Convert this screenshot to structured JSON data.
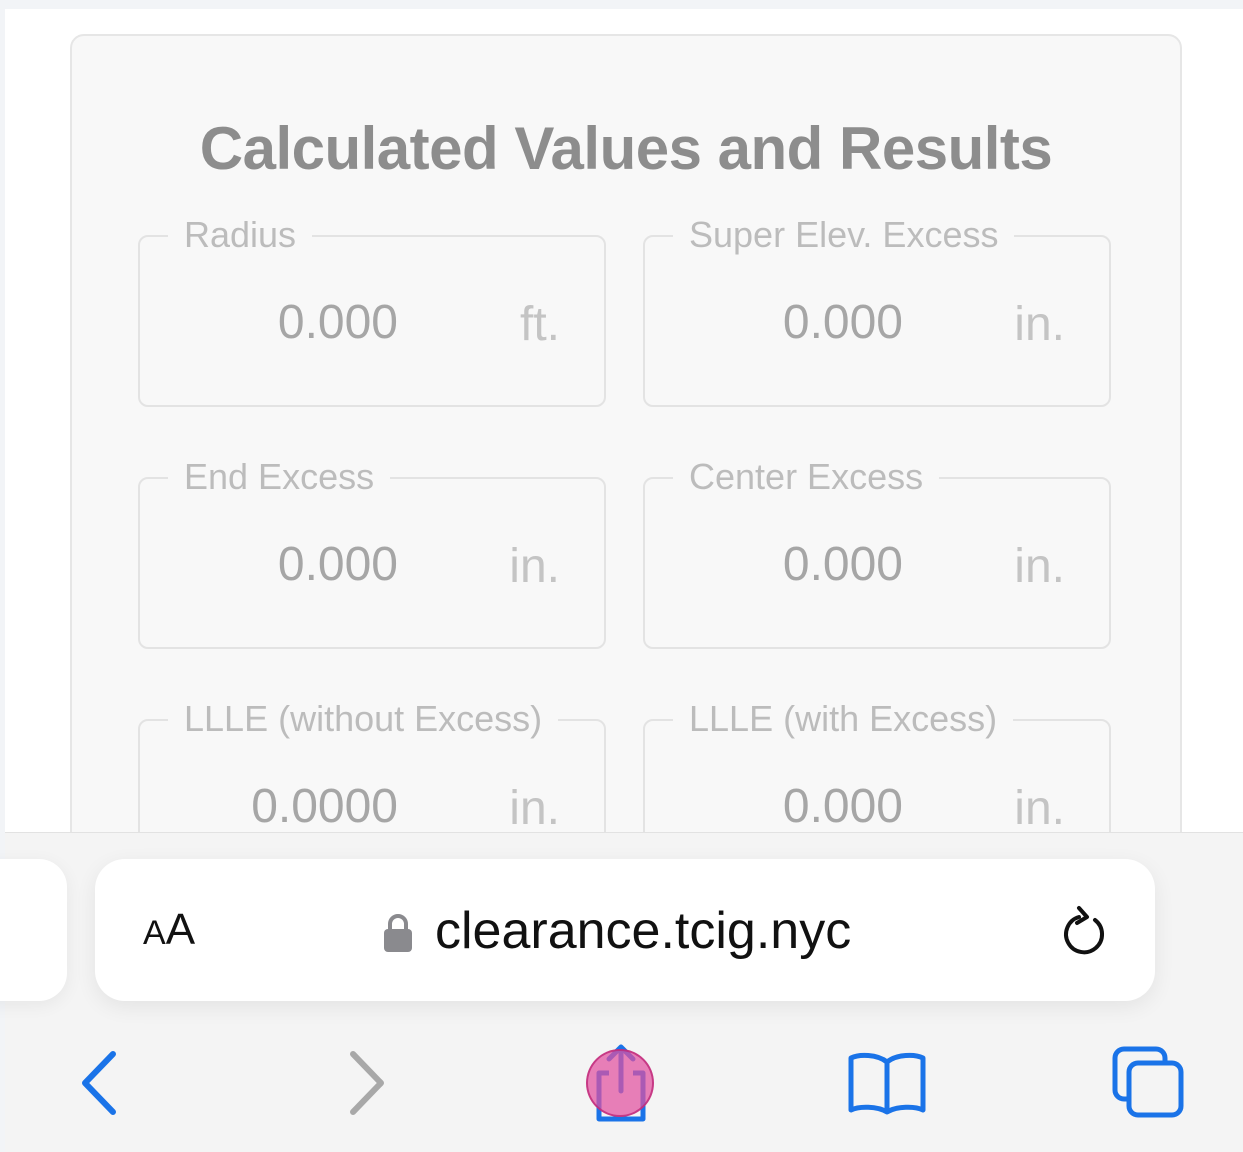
{
  "card": {
    "title": "Calculated Values and Results",
    "fields": [
      {
        "label": "Radius",
        "value": "0.000",
        "unit": "ft."
      },
      {
        "label": "Super Elev. Excess",
        "value": "0.000",
        "unit": "in."
      },
      {
        "label": "End Excess",
        "value": "0.000",
        "unit": "in."
      },
      {
        "label": "Center Excess",
        "value": "0.000",
        "unit": "in."
      },
      {
        "label": "LLLE (without Excess)",
        "value": "0.0000",
        "unit": "in."
      },
      {
        "label": "LLLE (with Excess)",
        "value": "0.000",
        "unit": "in."
      }
    ]
  },
  "browser": {
    "text_size_small": "A",
    "text_size_large": "A",
    "url": "clearance.tcig.nyc",
    "accent_color": "#1a73e8",
    "disabled_color": "#a8a8a8",
    "touch_indicator_color": "#e250a0",
    "icons": [
      "back-icon",
      "forward-icon",
      "share-icon",
      "bookmarks-icon",
      "tabs-icon",
      "lock-icon",
      "reload-icon"
    ]
  }
}
